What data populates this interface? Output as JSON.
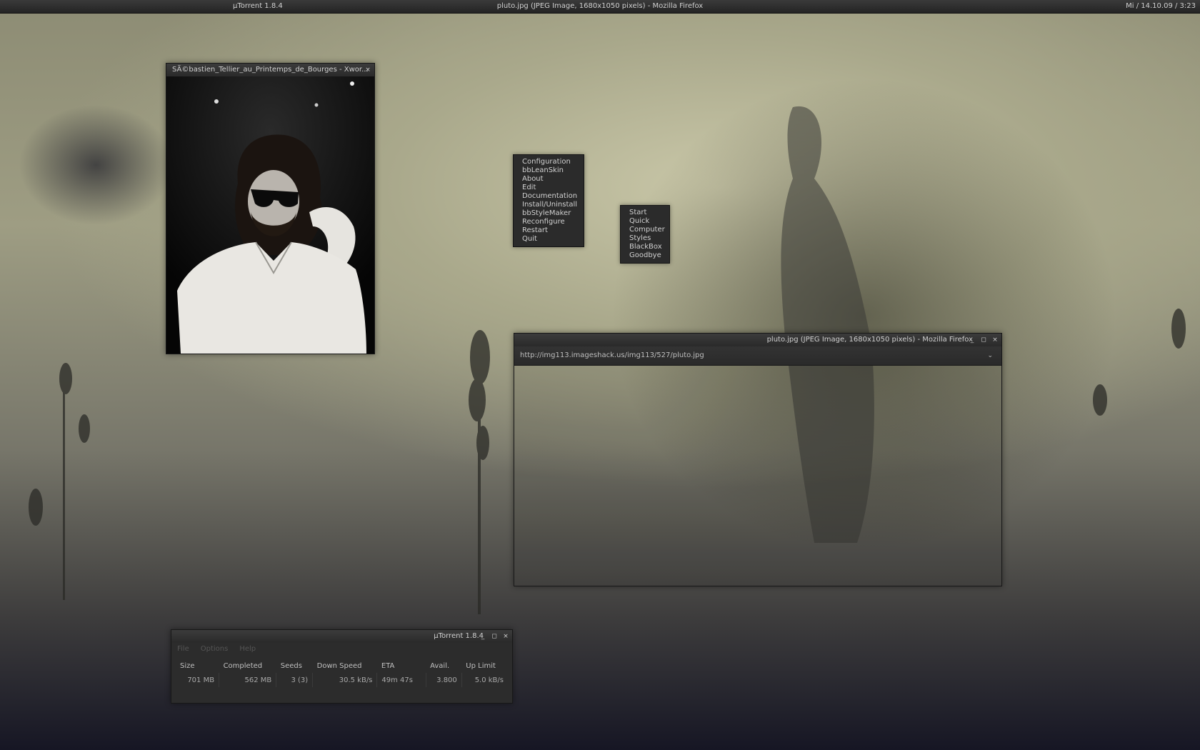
{
  "topbar": {
    "left": "µTorrent 1.8.4",
    "center": "pluto.jpg (JPEG Image, 1680x1050 pixels) - Mozilla Firefox",
    "right": "Mi / 14.10.09 / 3:23"
  },
  "viewer": {
    "title": "SÃ©bastien_Tellier_au_Printemps_de_Bourges - Xwor...",
    "close_icon": "×"
  },
  "root_menu": {
    "items": [
      "Configuration",
      "bbLeanSkin",
      "About",
      "Edit",
      "Documentation",
      "Install/Uninstall",
      "bbStyleMaker",
      "Reconfigure",
      "Restart",
      "Quit"
    ]
  },
  "sub_menu": {
    "items": [
      "Start",
      "Quick",
      "Computer",
      "Styles",
      "BlackBox",
      "Goodbye"
    ]
  },
  "firefox": {
    "title": "pluto.jpg (JPEG Image, 1680x1050 pixels) - Mozilla Firefox",
    "url": "http://img113.imageshack.us/img113/527/pluto.jpg",
    "dropdown": "⌄",
    "minimize": "_",
    "maximize": "◻",
    "close": "×"
  },
  "utorrent": {
    "title": "µTorrent 1.8.4",
    "minimize": "_",
    "maximize": "◻",
    "close": "×",
    "menu": [
      "File",
      "Options",
      "Help"
    ],
    "columns": [
      "Size",
      "Completed",
      "Seeds",
      "Down Speed",
      "ETA",
      "Avail.",
      "Up Limit"
    ],
    "row": [
      "701 MB",
      "562 MB",
      "3 (3)",
      "30.5 kB/s",
      "49m 47s",
      "3.800",
      "5.0 kB/s"
    ]
  },
  "colors": {
    "chrome": "#2c2c2c",
    "text": "#c8c8c8"
  }
}
